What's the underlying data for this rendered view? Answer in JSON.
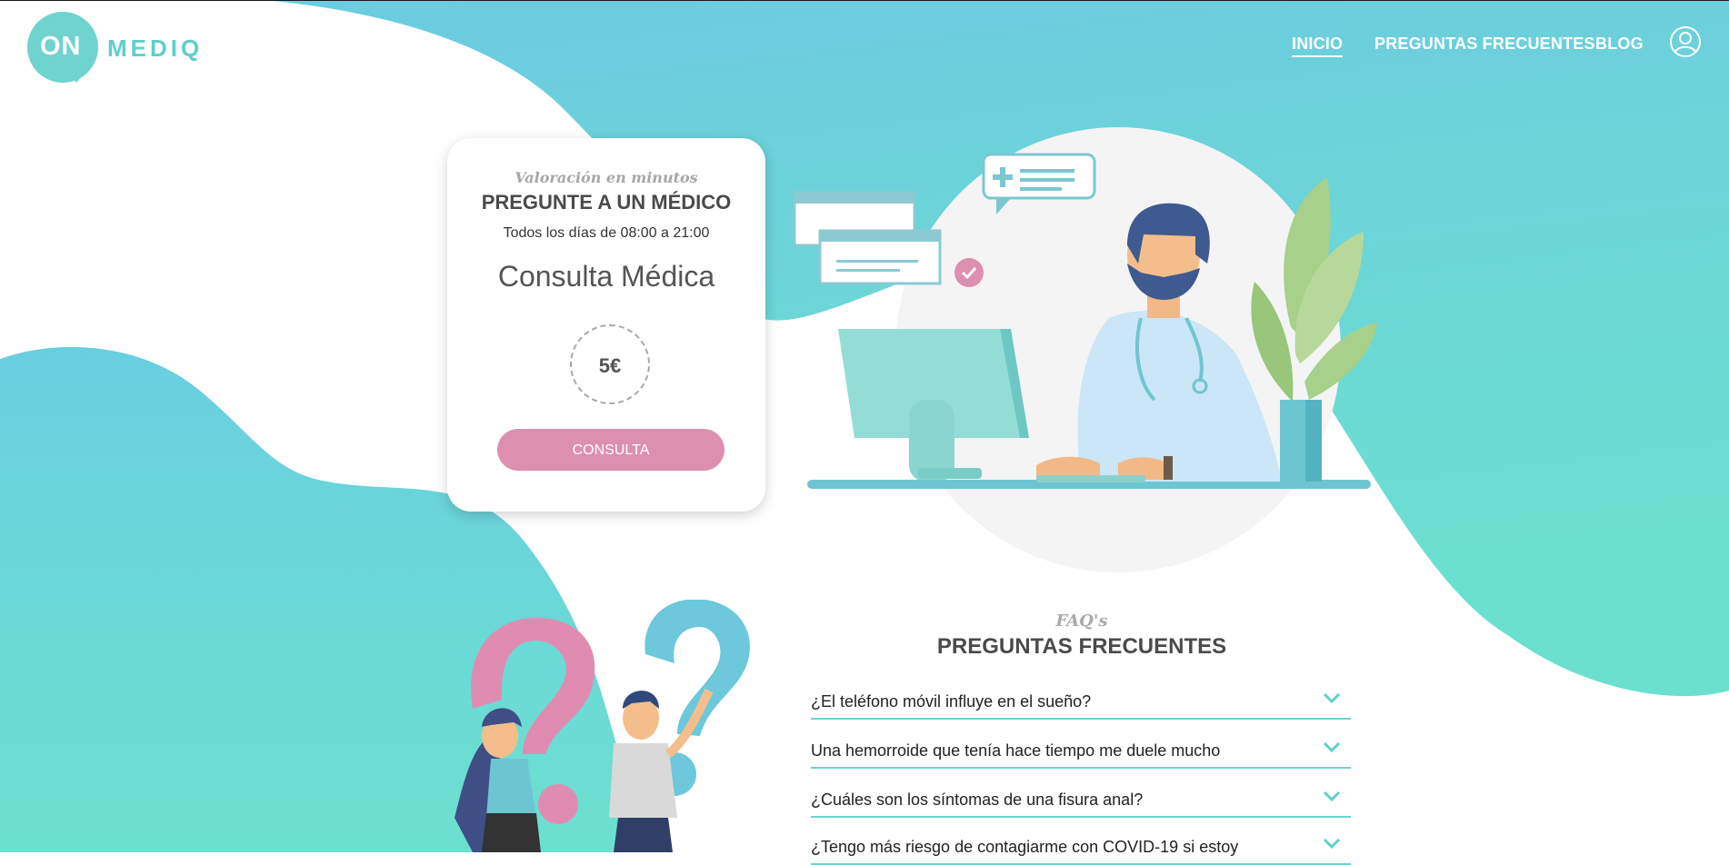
{
  "header": {
    "logo": {
      "on": "ON",
      "mediq": "MEDIQ"
    },
    "nav": [
      {
        "label": "INICIO",
        "active": true
      },
      {
        "label": "PREGUNTAS FRECUENTES",
        "active": false
      },
      {
        "label": "BLOG",
        "active": false
      }
    ],
    "user_icon": "user-circle-icon"
  },
  "card": {
    "tagline": "Valoración en minutos",
    "title": "PREGUNTE A UN MÉDICO",
    "hours": "Todos los días de 08:00 a 21:00",
    "service": "Consulta Médica",
    "price": "5€",
    "button_label": "CONSULTA"
  },
  "faq": {
    "tagline": "FAQ's",
    "title": "PREGUNTAS FRECUENTES",
    "items": [
      {
        "question": "¿El teléfono móvil influye en el sueño?"
      },
      {
        "question": "Una hemorroide que tenía hace tiempo me duele mucho"
      },
      {
        "question": "¿Cuáles son los síntomas de una fisura anal?"
      },
      {
        "question": "¿Tengo más riesgo de contagiarme con COVID-19 si estoy"
      }
    ]
  },
  "colors": {
    "teal": "#6fd3cf",
    "teal_light": "#6cc6e0",
    "pink_button": "#dd8fb0",
    "text_dark": "#4a4a4a"
  }
}
